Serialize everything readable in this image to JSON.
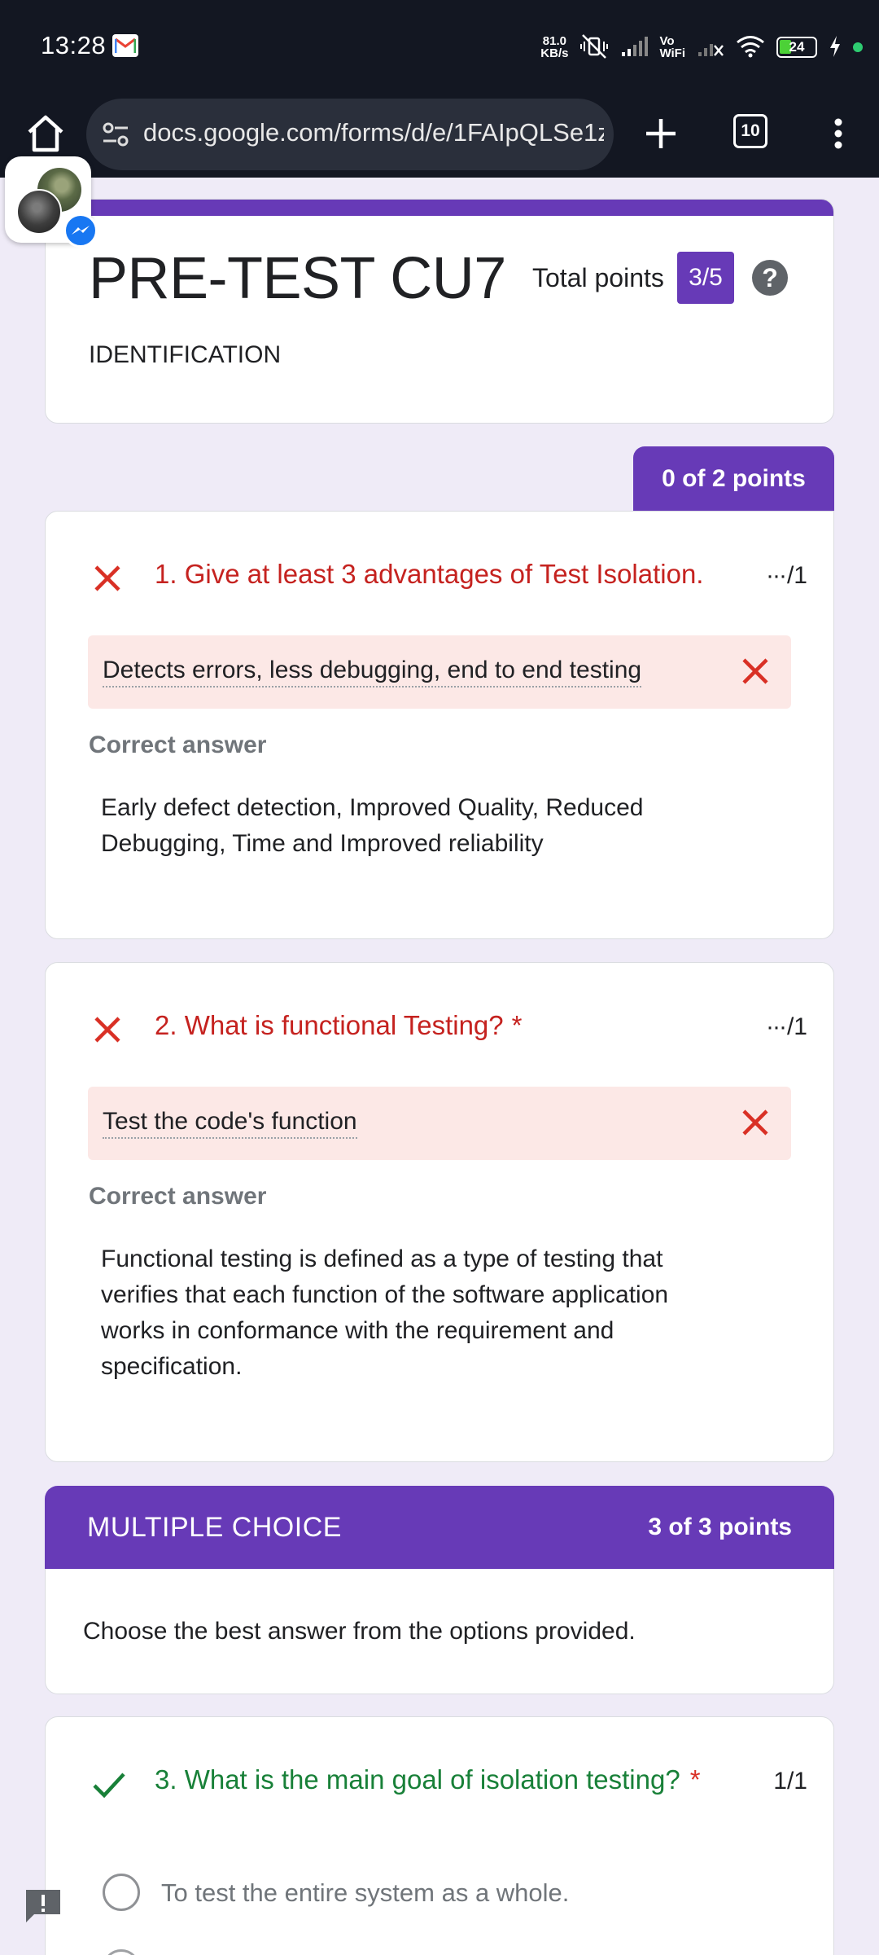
{
  "status_bar": {
    "time": "13:28",
    "speed_value": "81.0",
    "speed_unit": "KB/s",
    "vowifi_top": "Vo",
    "vowifi_bottom": "WiFi",
    "battery": "24",
    "icons": [
      "gmail-icon",
      "mute-vibrate-icon",
      "signal-icon",
      "no-signal-icon",
      "wifi-icon",
      "battery-icon",
      "charging-icon"
    ]
  },
  "browser": {
    "url": "docs.google.com/forms/d/e/1FAIpQLSe1z",
    "tab_count": "10"
  },
  "form": {
    "title": "PRE-TEST CU7",
    "total_points_label": "Total points",
    "total_score": "3/5",
    "help": "?",
    "description": "IDENTIFICATION",
    "section1_points": "0 of 2 points"
  },
  "questions": [
    {
      "text": "1. Give at least 3 advantages of Test Isolation.",
      "points_dots": "···",
      "points": "/1",
      "answer": "Detects errors, less debugging, end to end testing",
      "correct_label": "Correct answer",
      "correct_answer": "Early defect detection, Improved Quality, Reduced Debugging, Time and Improved reliability"
    },
    {
      "text": "2. What is functional Testing?",
      "required": "*",
      "points_dots": "···",
      "points": "/1",
      "answer": "Test the code's function",
      "correct_label": "Correct answer",
      "correct_answer": "Functional testing is defined as a type of testing that verifies that each function of the software application works in conformance with the requirement and specification."
    }
  ],
  "section2": {
    "title": "MULTIPLE CHOICE",
    "points": "3 of 3 points",
    "description": "Choose the best answer from the options provided."
  },
  "question3": {
    "text": "3. What is the main goal of isolation testing?",
    "required": "*",
    "points": "1/1",
    "option1": "To test the entire system as a whole."
  },
  "colors": {
    "accent": "#673ab7",
    "incorrect": "#c5221f",
    "correct": "#188038",
    "incorrect_bg": "#fce8e6",
    "page_bg": "#efebf7"
  }
}
